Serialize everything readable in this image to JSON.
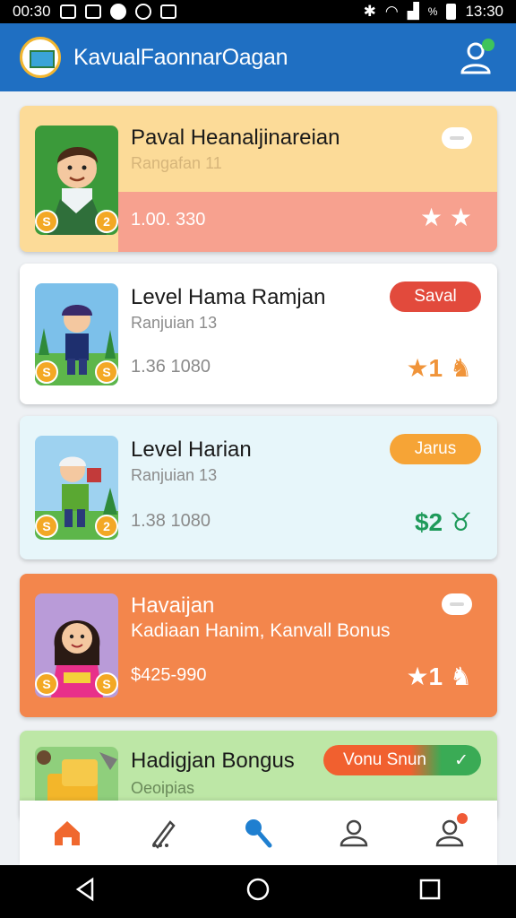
{
  "status_bar": {
    "time_left": "00:30",
    "battery_label": "%",
    "time_right": "13:30"
  },
  "app": {
    "title": "KavualFaonnarOagan"
  },
  "cards": [
    {
      "title": "Paval Heanaljinareian",
      "subtitle": "Rangafan 11",
      "amount": "1.00. 330",
      "reward": "★ ★",
      "coin_left": "S",
      "coin_right": "2"
    },
    {
      "title": "Level Hama Ramjan",
      "subtitle": "Ranjuian 13",
      "amount": "1.36 1080",
      "badge": "Saval",
      "reward": "★1 ♞",
      "coin_left": "S",
      "coin_right": "S"
    },
    {
      "title": "Level Harian",
      "subtitle": "Ranjuian 13",
      "amount": "1.38 1080",
      "badge": "Jarus",
      "reward": "$2 ♉",
      "coin_left": "S",
      "coin_right": "2"
    },
    {
      "title": "Havaijan",
      "subtitle": "Kadiaan Hanim, Kanvall Bonus",
      "amount": "$425-990",
      "reward": "★1 ♞",
      "coin_left": "S",
      "coin_right": "S"
    },
    {
      "title": "Hadigjan Bongus",
      "subtitle": "Oeoipias",
      "badge": "Vonu Snun",
      "badge_check": "✓"
    }
  ],
  "colors": {
    "appbar": "#1f6fc2",
    "card1_bg": "#fcdb98",
    "card1_band": "#f7a18f",
    "card4_bg": "#f3864c",
    "card5_bg": "#bde7a6",
    "badge_red": "#e24a3c",
    "badge_orange": "#f6a436",
    "badge_green": "#3aab55",
    "reward_orange": "#f0943a",
    "reward_green": "#1e9a5a"
  },
  "icons": {
    "bottom_nav": [
      "home-icon",
      "edit-icon",
      "search-icon",
      "user-icon",
      "user-notification-icon"
    ],
    "system_nav": [
      "back-icon",
      "home-circle-icon",
      "recents-icon"
    ]
  }
}
